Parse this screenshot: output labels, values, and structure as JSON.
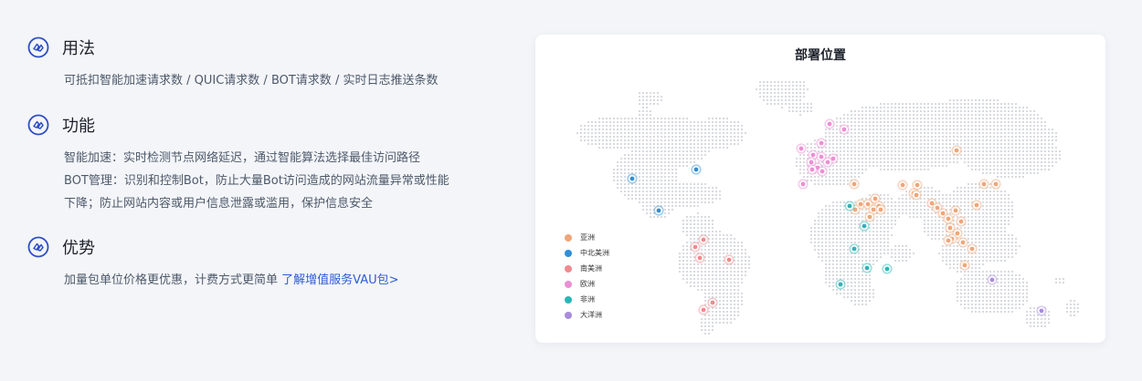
{
  "sections": [
    {
      "title": "用法",
      "lines": [
        "可抵扣智能加速请求数 / QUIC请求数 / BOT请求数 / 实时日志推送条数"
      ]
    },
    {
      "title": "功能",
      "lines": [
        "智能加速：实时检测节点网络延迟，通过智能算法选择最佳访问路径",
        "BOT管理：识别和控制Bot，防止大量Bot访问造成的网站流量异常或性能",
        "下降；防止网站内容或用户信息泄露或滥用，保护信息安全"
      ]
    },
    {
      "title": "优势",
      "text": "加量包单位价格更优惠，计费方式更简单",
      "link": "了解增值服务VAU包>"
    }
  ],
  "map": {
    "title": "部署位置",
    "regions": [
      {
        "name": "亚洲",
        "color": "#f0a67a"
      },
      {
        "name": "中北美洲",
        "color": "#2f8fd8"
      },
      {
        "name": "南美洲",
        "color": "#ef8a8f"
      },
      {
        "name": "欧洲",
        "color": "#ec8fd3"
      },
      {
        "name": "非洲",
        "color": "#2bb6b8"
      },
      {
        "name": "大洋洲",
        "color": "#a88ddd"
      }
    ]
  }
}
